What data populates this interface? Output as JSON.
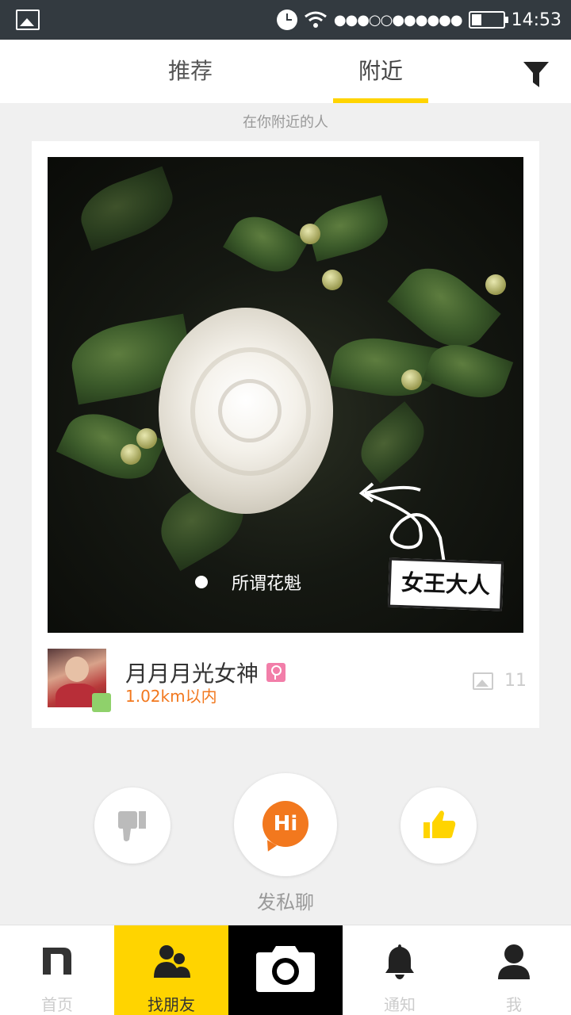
{
  "status_bar": {
    "time": "14:53",
    "signal_dots": "●●●○○●●●●●●",
    "icons": [
      "image-icon",
      "clock-icon",
      "wifi-icon",
      "battery-icon"
    ]
  },
  "tabs": [
    {
      "label": "推荐",
      "active": false
    },
    {
      "label": "附近",
      "active": true
    }
  ],
  "filter_icon": "filter-icon",
  "subtitle": "在你附近的人",
  "card": {
    "caption": "所谓花魁",
    "stamp_text": "女王大人",
    "user": {
      "name": "月月月光女神",
      "gender": "female",
      "distance": "1.02km以内",
      "online": true
    },
    "photo_count": "11"
  },
  "actions": {
    "dislike_icon": "thumbs-down-icon",
    "hi_label": "Hi",
    "like_icon": "thumbs-up-icon",
    "chat_label": "发私聊"
  },
  "bottom_nav": [
    {
      "label": "首页",
      "icon": "home-n-icon",
      "active": false
    },
    {
      "label": "找朋友",
      "icon": "friends-icon",
      "active": true
    },
    {
      "label": "",
      "icon": "camera-icon",
      "active": false
    },
    {
      "label": "通知",
      "icon": "bell-icon",
      "active": false
    },
    {
      "label": "我",
      "icon": "person-icon",
      "active": false
    }
  ],
  "colors": {
    "accent_yellow": "#ffd400",
    "accent_orange": "#f2781e",
    "status_bar_bg": "#333a40"
  }
}
